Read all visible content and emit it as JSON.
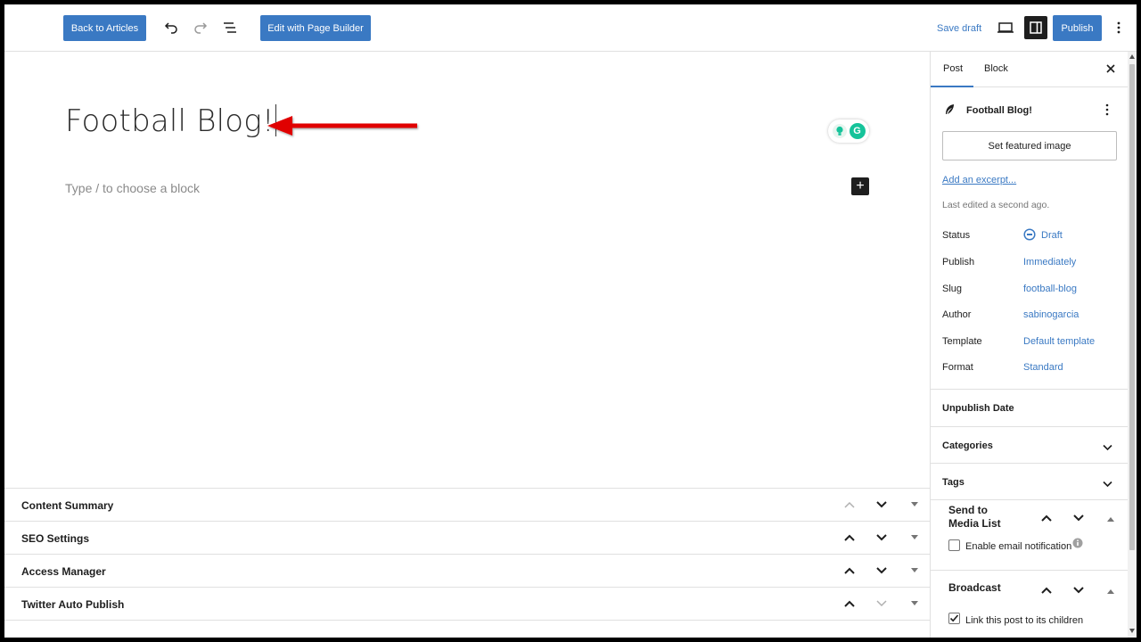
{
  "toolbar": {
    "back_label": "Back to Articles",
    "page_builder_label": "Edit with Page Builder",
    "save_draft_label": "Save draft",
    "publish_label": "Publish",
    "icons": [
      "undo-icon",
      "redo-icon",
      "document-overview-icon",
      "preview-desktop-icon",
      "settings-sidebar-icon",
      "more-options-icon"
    ]
  },
  "editor": {
    "post_title": "Football Blog!",
    "block_placeholder": "Type / to choose a block",
    "add_block_symbol": "+",
    "grammarly_letter": "G"
  },
  "metaboxes": [
    {
      "title": "Content Summary"
    },
    {
      "title": "SEO Settings"
    },
    {
      "title": "Access Manager"
    },
    {
      "title": "Twitter Auto Publish"
    }
  ],
  "sidebar": {
    "tab_post": "Post",
    "tab_block": "Block",
    "post_name": "Football Blog!",
    "featured_image_button": "Set featured image",
    "excerpt_link": "Add an excerpt...",
    "last_edited": "Last edited a second ago.",
    "rows": [
      {
        "label": "Status",
        "value": "Draft"
      },
      {
        "label": "Publish",
        "value": "Immediately"
      },
      {
        "label": "Slug",
        "value": "football-blog"
      },
      {
        "label": "Author",
        "value": "sabinogarcia"
      },
      {
        "label": "Template",
        "value": "Default template"
      },
      {
        "label": "Format",
        "value": "Standard"
      }
    ],
    "unpublish_date": "Unpublish Date",
    "categories": "Categories",
    "tags": "Tags",
    "send_to_media_line1": "Send to",
    "send_to_media_line2": "Media List",
    "email_notification": "Enable email notification",
    "email_notification_checked": false,
    "broadcast": "Broadcast",
    "link_children": "Link this post to its children",
    "link_children_checked": true
  },
  "colors": {
    "accent": "#3a79c3",
    "annotation_arrow": "#e00000",
    "dark": "#1e1e1e"
  }
}
